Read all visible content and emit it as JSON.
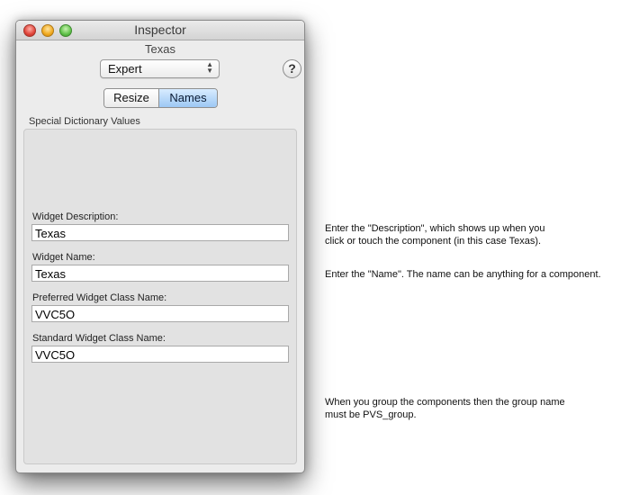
{
  "window": {
    "title": "Inspector",
    "subject": "Texas",
    "controls": [
      "close",
      "minimize",
      "zoom"
    ]
  },
  "mode_popup": {
    "selected": "Expert",
    "arrows_icon": "updown-arrows-icon"
  },
  "help_button": {
    "label": "?"
  },
  "segmented": {
    "items": [
      {
        "label": "Resize",
        "selected": false
      },
      {
        "label": "Names",
        "selected": true
      }
    ]
  },
  "group": {
    "label": "Special Dictionary Values",
    "fields": [
      {
        "label": "Widget Description:",
        "value": "Texas"
      },
      {
        "label": "Widget Name:",
        "value": "Texas"
      },
      {
        "label": "Preferred Widget Class Name:",
        "value": "VVC5O"
      },
      {
        "label": "Standard Widget Class Name:",
        "value": "VVC5O"
      }
    ]
  },
  "notes": [
    {
      "lines": [
        "Enter the \"Description\", which shows up when you",
        "click or touch the component (in this case Texas)."
      ]
    },
    {
      "lines": [
        "Enter the \"Name\". The name can be anything for a component."
      ]
    },
    {
      "lines": [
        "When you group the components then the group name",
        "must be PVS_group."
      ]
    }
  ]
}
